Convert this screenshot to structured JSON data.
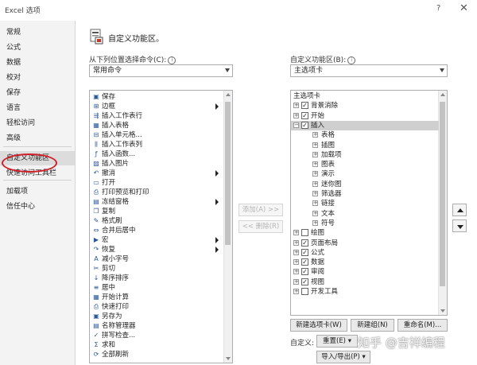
{
  "window": {
    "title": "Excel 选项",
    "help": "?",
    "close": "✕"
  },
  "sidebar": {
    "items": [
      {
        "label": "常规"
      },
      {
        "label": "公式"
      },
      {
        "label": "数据"
      },
      {
        "label": "校对"
      },
      {
        "label": "保存"
      },
      {
        "label": "语言"
      },
      {
        "label": "轻松访问"
      },
      {
        "label": "高级"
      },
      {
        "label": "自定义功能区",
        "selected": true
      },
      {
        "label": "快速访问工具栏"
      },
      {
        "label": "加载项"
      },
      {
        "label": "信任中心"
      }
    ]
  },
  "header": {
    "title": "自定义功能区。"
  },
  "left": {
    "label": "从下列位置选择命令(C):",
    "dropdown_value": "常用命令",
    "commands": [
      {
        "label": "保存",
        "icon": "save-icon",
        "glyph": "▣"
      },
      {
        "label": "边框",
        "icon": "border-icon",
        "glyph": "⊞",
        "submenu": true
      },
      {
        "label": "插入工作表行",
        "icon": "insert-row-icon",
        "glyph": "⇶"
      },
      {
        "label": "插入表格",
        "icon": "insert-table-icon",
        "glyph": "▦"
      },
      {
        "label": "插入单元格...",
        "icon": "insert-cell-icon",
        "glyph": "⊟"
      },
      {
        "label": "插入工作表列",
        "icon": "insert-column-icon",
        "glyph": "⫼"
      },
      {
        "label": "插入函数...",
        "icon": "function-icon",
        "glyph": "ƒ"
      },
      {
        "label": "插入图片",
        "icon": "picture-icon",
        "glyph": "▨"
      },
      {
        "label": "撤消",
        "icon": "undo-icon",
        "glyph": "↶",
        "submenu": true
      },
      {
        "label": "打开",
        "icon": "open-icon",
        "glyph": "▭"
      },
      {
        "label": "打印预览和打印",
        "icon": "print-preview-icon",
        "glyph": "⎙"
      },
      {
        "label": "冻结窗格",
        "icon": "freeze-panes-icon",
        "glyph": "▤",
        "submenu": true
      },
      {
        "label": "复制",
        "icon": "copy-icon",
        "glyph": "❐"
      },
      {
        "label": "格式刷",
        "icon": "format-painter-icon",
        "glyph": "✎"
      },
      {
        "label": "合并后居中",
        "icon": "merge-center-icon",
        "glyph": "⇔"
      },
      {
        "label": "宏",
        "icon": "macro-icon",
        "glyph": "▶",
        "submenu": true
      },
      {
        "label": "恢复",
        "icon": "redo-icon",
        "glyph": "↷",
        "submenu": true
      },
      {
        "label": "减小字号",
        "icon": "decrease-font-icon",
        "glyph": "A"
      },
      {
        "label": "剪切",
        "icon": "cut-icon",
        "glyph": "✂"
      },
      {
        "label": "降序排序",
        "icon": "sort-desc-icon",
        "glyph": "↓"
      },
      {
        "label": "居中",
        "icon": "center-icon",
        "glyph": "≡"
      },
      {
        "label": "开始计算",
        "icon": "calculate-icon",
        "glyph": "▦"
      },
      {
        "label": "快速打印",
        "icon": "quick-print-icon",
        "glyph": "⎙"
      },
      {
        "label": "另存为",
        "icon": "save-as-icon",
        "glyph": "▣"
      },
      {
        "label": "名称管理器",
        "icon": "name-manager-icon",
        "glyph": "▤"
      },
      {
        "label": "拼写检查...",
        "icon": "spelling-icon",
        "glyph": "✓"
      },
      {
        "label": "求和",
        "icon": "sum-icon",
        "glyph": "Σ"
      },
      {
        "label": "全部刷新",
        "icon": "refresh-all-icon",
        "glyph": "⟳"
      }
    ]
  },
  "middle": {
    "add_label": "添加(A) >>",
    "remove_label": "<< 删除(R)"
  },
  "right": {
    "label": "自定义功能区(B):",
    "dropdown_value": "主选项卡",
    "tree": [
      {
        "label": "主选项卡",
        "level": "header"
      },
      {
        "label": "背景消除",
        "level": 0,
        "expand": "+",
        "checked": true
      },
      {
        "label": "开始",
        "level": 0,
        "expand": "+",
        "checked": true
      },
      {
        "label": "插入",
        "level": 0,
        "expand": "−",
        "checked": true,
        "selected": true
      },
      {
        "label": "表格",
        "level": 1,
        "expand": "+"
      },
      {
        "label": "插图",
        "level": 1,
        "expand": "+"
      },
      {
        "label": "加载项",
        "level": 1,
        "expand": "+"
      },
      {
        "label": "图表",
        "level": 1,
        "expand": "+"
      },
      {
        "label": "演示",
        "level": 1,
        "expand": "+"
      },
      {
        "label": "迷你图",
        "level": 1,
        "expand": "+"
      },
      {
        "label": "筛选器",
        "level": 1,
        "expand": "+"
      },
      {
        "label": "链接",
        "level": 1,
        "expand": "+"
      },
      {
        "label": "文本",
        "level": 1,
        "expand": "+"
      },
      {
        "label": "符号",
        "level": 1,
        "expand": "+"
      },
      {
        "label": "绘图",
        "level": 0,
        "expand": "+",
        "checked": false
      },
      {
        "label": "页面布局",
        "level": 0,
        "expand": "+",
        "checked": true
      },
      {
        "label": "公式",
        "level": 0,
        "expand": "+",
        "checked": true
      },
      {
        "label": "数据",
        "level": 0,
        "expand": "+",
        "checked": true
      },
      {
        "label": "审阅",
        "level": 0,
        "expand": "+",
        "checked": true
      },
      {
        "label": "视图",
        "level": 0,
        "expand": "+",
        "checked": true
      },
      {
        "label": "开发工具",
        "level": 0,
        "expand": "+",
        "checked": false
      }
    ],
    "new_tab_label": "新建选项卡(W)",
    "new_group_label": "新建组(N)",
    "rename_label": "重命名(M)...",
    "customize_label": "自定义:",
    "reset_label": "重置(E) ▾",
    "import_export_label": "导入/导出(P) ▾"
  },
  "watermark": {
    "text": "知乎 @吉祥编程"
  }
}
